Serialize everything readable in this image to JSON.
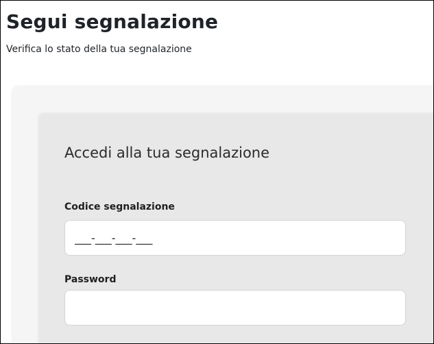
{
  "header": {
    "title": "Segui segnalazione",
    "subtitle": "Verifica lo stato della tua segnalazione"
  },
  "login_card": {
    "title": "Accedi alla tua segnalazione",
    "code_field": {
      "label": "Codice segnalazione",
      "placeholder": "___-___-___-___",
      "value": ""
    },
    "password_field": {
      "label": "Password",
      "placeholder": "",
      "value": ""
    }
  }
}
